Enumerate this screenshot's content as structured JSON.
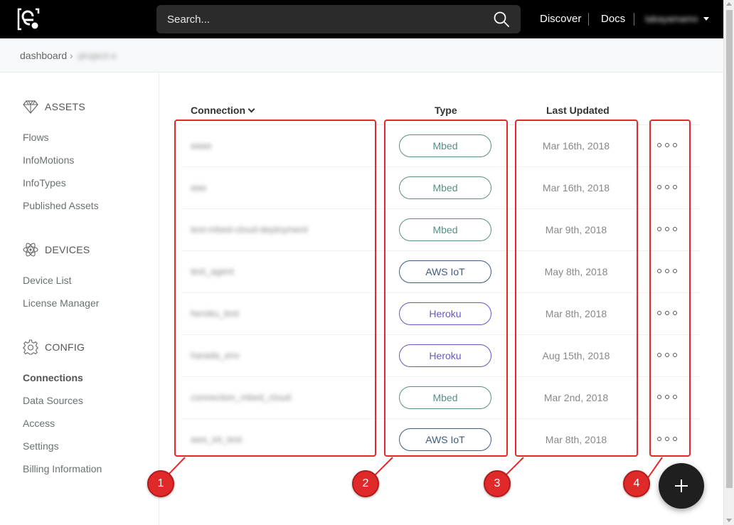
{
  "header": {
    "search_placeholder": "Search...",
    "nav": {
      "discover": "Discover",
      "docs": "Docs"
    },
    "user_name": "takayamamo"
  },
  "breadcrumb": {
    "root": "dashboard",
    "separator": "›",
    "current": "project-x"
  },
  "sidebar": {
    "assets_label": "ASSETS",
    "assets_items": [
      "Flows",
      "InfoMotions",
      "InfoTypes",
      "Published Assets"
    ],
    "devices_label": "DEVICES",
    "devices_items": [
      "Device List",
      "License Manager"
    ],
    "config_label": "CONFIG",
    "config_items": [
      "Connections",
      "Data Sources",
      "Access",
      "Settings",
      "Billing Information"
    ],
    "active_item": "Connections"
  },
  "table": {
    "columns": {
      "connection": "Connection",
      "type": "Type",
      "last_updated": "Last Updated"
    },
    "rows": [
      {
        "name": "aaaa",
        "type": "Mbed",
        "updated": "Mar 16th, 2018"
      },
      {
        "name": "aaa",
        "type": "Mbed",
        "updated": "Mar 16th, 2018"
      },
      {
        "name": "test-mbed-cloud-deployment",
        "type": "Mbed",
        "updated": "Mar 9th, 2018"
      },
      {
        "name": "test_agent",
        "type": "AWS IoT",
        "updated": "May 8th, 2018"
      },
      {
        "name": "heroku_test",
        "type": "Heroku",
        "updated": "Mar 8th, 2018"
      },
      {
        "name": "harada_env",
        "type": "Heroku",
        "updated": "Aug 15th, 2018"
      },
      {
        "name": "connection_mbed_cloud",
        "type": "Mbed",
        "updated": "Mar 2nd, 2018"
      },
      {
        "name": "aws_iot_test",
        "type": "AWS IoT",
        "updated": "Mar 8th, 2018"
      }
    ]
  },
  "annotations": [
    "1",
    "2",
    "3",
    "4"
  ],
  "colors": {
    "mbed": "#5a8f86",
    "aws": "#3d5c80",
    "heroku": "#6a56c9",
    "annotation_red": "#e8262b"
  }
}
